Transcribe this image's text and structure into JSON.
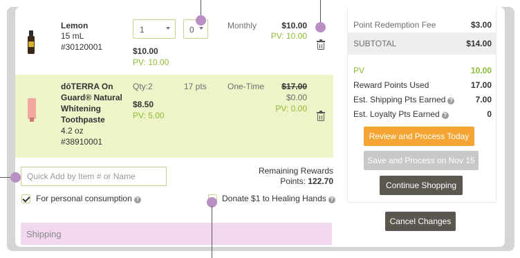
{
  "items": [
    {
      "name_lines": [
        "Lemon"
      ],
      "size": "15 mL",
      "sku": "#30120001",
      "qty_value": "1",
      "points_value": "0",
      "frequency": "Monthly",
      "total_price": "$10.00",
      "total_pv": "PV: 10.00",
      "unit_price": "$10.00",
      "unit_pv": "PV: 10.00"
    },
    {
      "name_lines": [
        "dōTERRA On",
        "Guard® Natural",
        "Whitening",
        "Toothpaste"
      ],
      "size": "4.2 oz",
      "sku": "#38910001",
      "qty_text": "Qty:2",
      "points_text": "17 pts",
      "frequency": "One-Time",
      "original_price": "$17.00",
      "total_price": "$0.00",
      "total_pv": "PV: 0.00",
      "unit_price": "$8.50",
      "unit_pv": "PV: 5.00"
    }
  ],
  "quick_add": {
    "placeholder": "Quick Add by Item # or Name"
  },
  "remaining_rewards": {
    "label": "Remaining Rewards",
    "points_label": "Points:",
    "points_value": "122.70"
  },
  "personal_consumption": {
    "label": "For personal consumption",
    "checked": true
  },
  "donate": {
    "label": "Donate $1 to Healing Hands",
    "checked": false
  },
  "shipping": {
    "label": "Shipping"
  },
  "summary": {
    "redemption_fee_label": "Point Redemption Fee",
    "redemption_fee_value": "$3.00",
    "subtotal_label": "SUBTOTAL",
    "subtotal_value": "$14.00",
    "pv_label": "PV",
    "pv_value": "10.00",
    "reward_points_label": "Reward Points Used",
    "reward_points_value": "17.00",
    "est_shipping_label": "Est. Shipping Pts Earned",
    "est_shipping_value": "7.00",
    "est_loyalty_label": "Est. Loyalty Pts Earned",
    "est_loyalty_value": "0"
  },
  "buttons": {
    "review": "Review and Process Today",
    "save": "Save and Process on Nov 15",
    "continue": "Continue Shopping",
    "cancel": "Cancel Changes"
  },
  "colors": {
    "accent_orange": "#f4a533",
    "pv_green": "#8dbb36",
    "row_highlight": "#eef3c8",
    "shipping_bar": "#f2d8ee",
    "annotation": "#b98ec4"
  }
}
